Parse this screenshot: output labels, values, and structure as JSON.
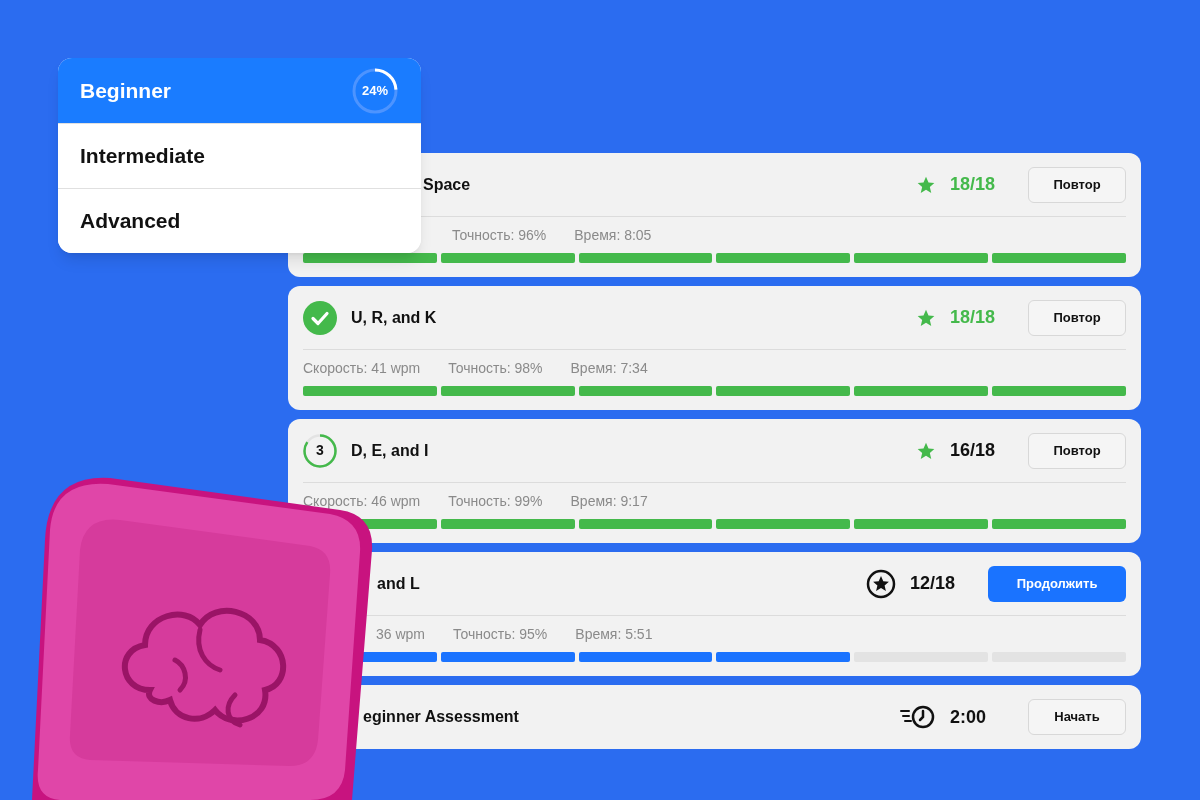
{
  "levels": [
    {
      "label": "Beginner",
      "selected": true,
      "progress_text": "24%"
    },
    {
      "label": "Intermediate",
      "selected": false
    },
    {
      "label": "Advanced",
      "selected": false
    }
  ],
  "lessons": [
    {
      "title": "Space",
      "score": {
        "kind": "star",
        "text": "18/18",
        "color": "#44b94b"
      },
      "button": {
        "label": "Повтор",
        "kind": "secondary"
      },
      "stats": [
        "Точность: 96%",
        "Время: 8:05"
      ],
      "segments": [
        {
          "color": "#44b94b"
        },
        {
          "color": "#44b94b"
        },
        {
          "color": "#44b94b"
        },
        {
          "color": "#44b94b"
        },
        {
          "color": "#44b94b"
        },
        {
          "color": "#44b94b"
        }
      ]
    },
    {
      "lead": {
        "kind": "check"
      },
      "title": "U, R, and K",
      "score": {
        "kind": "star",
        "text": "18/18",
        "color": "#44b94b"
      },
      "button": {
        "label": "Повтор",
        "kind": "secondary"
      },
      "stats": [
        "Скорость: 41 wpm",
        "Точность: 98%",
        "Время: 7:34"
      ],
      "segments": [
        {
          "color": "#44b94b"
        },
        {
          "color": "#44b94b"
        },
        {
          "color": "#44b94b"
        },
        {
          "color": "#44b94b"
        },
        {
          "color": "#44b94b"
        },
        {
          "color": "#44b94b"
        }
      ]
    },
    {
      "lead": {
        "kind": "number",
        "text": "3"
      },
      "title": "D, E, and I",
      "score": {
        "kind": "star",
        "text": "16/18",
        "color": "#111111"
      },
      "button": {
        "label": "Повтор",
        "kind": "secondary"
      },
      "stats": [
        "Скорость: 46 wpm",
        "Точность: 99%",
        "Время: 9:17"
      ],
      "segments": [
        {
          "color": "#44b94b"
        },
        {
          "color": "#44b94b"
        },
        {
          "color": "#44b94b"
        },
        {
          "color": "#44b94b"
        },
        {
          "color": "#44b94b"
        },
        {
          "color": "#44b94b"
        }
      ]
    },
    {
      "title": "and L",
      "score": {
        "kind": "star_circle",
        "text": "12/18",
        "color": "#111111"
      },
      "button": {
        "label": "Продолжить",
        "kind": "primary"
      },
      "stats": [
        "36 wpm",
        "Точность: 95%",
        "Время: 5:51"
      ],
      "segments": [
        {
          "color": "#1a73ff"
        },
        {
          "color": "#1a73ff"
        },
        {
          "color": "#1a73ff"
        },
        {
          "color": "#1a73ff"
        },
        {
          "color": "#e3e3e3"
        },
        {
          "color": "#e3e3e3"
        }
      ]
    },
    {
      "title": "eginner Assessment",
      "score": {
        "kind": "timer",
        "text": "2:00",
        "color": "#111111"
      },
      "button": {
        "label": "Начать",
        "kind": "secondary"
      }
    }
  ]
}
